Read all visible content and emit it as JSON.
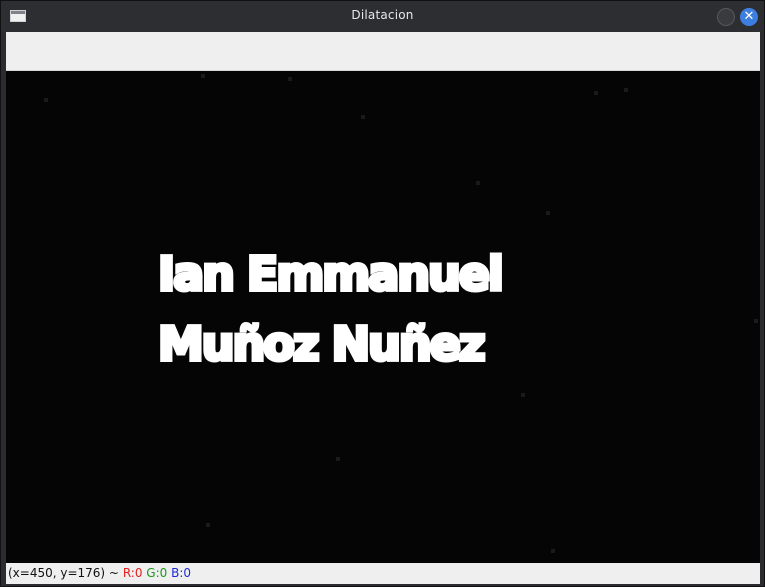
{
  "window": {
    "title": "Dilatacion"
  },
  "image": {
    "lines": [
      "Ian Emmanuel",
      "Muñoz Nuñez"
    ]
  },
  "status": {
    "coords": "(x=450, y=176) ~",
    "r": "R:0",
    "g": "G:0",
    "b": "B:0"
  },
  "colors": {
    "close_button": "#3d7fe0",
    "canvas_background": "#050505",
    "text": "#ffffff",
    "r_label": "#e0201b",
    "g_label": "#1a9a1a",
    "b_label": "#1f2ad8"
  }
}
